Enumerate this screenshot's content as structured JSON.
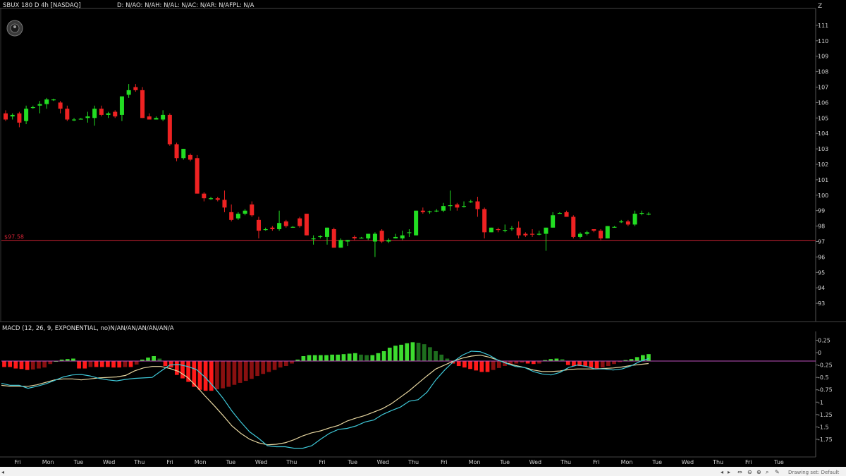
{
  "header": {
    "symbol_line": "SBUX 180 D 4h [NASDAQ]",
    "data_line": "D: N/AO: N/AH: N/AL: N/AC: N/AR: N/AFPL: N/A",
    "zoom_glyph": "Z"
  },
  "macd_header": "MACD (12, 26, 9, EXPONENTIAL, no)N/AN/AN/AN/AN/AN/A",
  "price_tag": "$97.58",
  "footer_right": "Drawing set: Default",
  "colors": {
    "up": "#22dd22",
    "down": "#ee2222",
    "up_light": "#3ddc2f",
    "up_dark": "#1e6e1e",
    "down_light": "#ff1a1a",
    "down_dark": "#8a1010",
    "macd_line": "#3ec8d8",
    "avg_line": "#e6d6a0",
    "zero_line": "#c050c0",
    "price_line": "#cc2233"
  },
  "chart_data": [
    {
      "type": "candlestick",
      "title": "SBUX 180 D 4h [NASDAQ]",
      "ylim": [
        92,
        112
      ],
      "y_ticks": [
        93,
        94,
        95,
        96,
        97,
        98,
        99,
        100,
        101,
        102,
        103,
        104,
        105,
        106,
        107,
        108,
        109,
        110,
        111
      ],
      "x_labels": [
        "Fri",
        "Mon",
        "Tue",
        "Wed",
        "Thu",
        "Fri",
        "Mon",
        "Tue",
        "Wed",
        "Thu",
        "Fri",
        "Tue",
        "Wed",
        "Thu",
        "Fri",
        "Mon",
        "Tue",
        "Wed",
        "Thu",
        "Fri",
        "Mon",
        "Tue",
        "Wed",
        "Thu",
        "Fri",
        "Tue"
      ],
      "horizontal_line": 97.05,
      "candles": [
        {
          "o": 105.3,
          "h": 105.5,
          "l": 104.8,
          "c": 104.9
        },
        {
          "o": 105.1,
          "h": 105.3,
          "l": 104.9,
          "c": 105.2
        },
        {
          "o": 105.3,
          "h": 105.4,
          "l": 104.4,
          "c": 104.7
        },
        {
          "o": 104.8,
          "h": 105.8,
          "l": 104.6,
          "c": 105.6
        },
        {
          "o": 105.7,
          "h": 105.8,
          "l": 105.6,
          "c": 105.7
        },
        {
          "o": 105.8,
          "h": 106.1,
          "l": 105.3,
          "c": 105.9
        },
        {
          "o": 105.9,
          "h": 106.3,
          "l": 105.6,
          "c": 106.2
        },
        {
          "o": 106.2,
          "h": 106.25,
          "l": 106.1,
          "c": 106.2
        },
        {
          "o": 106.0,
          "h": 106.1,
          "l": 105.3,
          "c": 105.6
        },
        {
          "o": 105.6,
          "h": 105.8,
          "l": 104.8,
          "c": 104.9
        },
        {
          "o": 104.9,
          "h": 105.0,
          "l": 104.8,
          "c": 104.9
        },
        {
          "o": 104.95,
          "h": 105.0,
          "l": 104.9,
          "c": 104.95
        },
        {
          "o": 105.0,
          "h": 105.4,
          "l": 104.7,
          "c": 105.1
        },
        {
          "o": 105.0,
          "h": 105.8,
          "l": 104.5,
          "c": 105.6
        },
        {
          "o": 105.6,
          "h": 105.8,
          "l": 105.1,
          "c": 105.2
        },
        {
          "o": 105.2,
          "h": 105.4,
          "l": 105.0,
          "c": 105.3
        },
        {
          "o": 105.4,
          "h": 105.5,
          "l": 105.0,
          "c": 105.1
        },
        {
          "o": 105.2,
          "h": 106.2,
          "l": 104.8,
          "c": 106.4
        },
        {
          "o": 106.5,
          "h": 107.2,
          "l": 106.3,
          "c": 106.8
        },
        {
          "o": 107.0,
          "h": 107.2,
          "l": 106.7,
          "c": 106.8
        },
        {
          "o": 106.8,
          "h": 107.0,
          "l": 105.0,
          "c": 105.0
        },
        {
          "o": 105.1,
          "h": 105.3,
          "l": 104.9,
          "c": 104.9
        },
        {
          "o": 104.9,
          "h": 105.1,
          "l": 104.9,
          "c": 105.0
        },
        {
          "o": 104.9,
          "h": 105.5,
          "l": 104.8,
          "c": 105.2
        },
        {
          "o": 105.2,
          "h": 105.3,
          "l": 103.2,
          "c": 103.3
        },
        {
          "o": 103.3,
          "h": 103.4,
          "l": 102.2,
          "c": 102.4
        },
        {
          "o": 102.4,
          "h": 103.0,
          "l": 102.3,
          "c": 103.0
        },
        {
          "o": 102.6,
          "h": 102.7,
          "l": 102.2,
          "c": 102.3
        },
        {
          "o": 102.4,
          "h": 102.6,
          "l": 100.1,
          "c": 100.1
        },
        {
          "o": 100.1,
          "h": 100.2,
          "l": 99.6,
          "c": 99.8
        },
        {
          "o": 99.8,
          "h": 99.9,
          "l": 99.7,
          "c": 99.8
        },
        {
          "o": 99.8,
          "h": 99.9,
          "l": 99.6,
          "c": 99.7
        },
        {
          "o": 99.7,
          "h": 100.3,
          "l": 98.9,
          "c": 99.2
        },
        {
          "o": 98.9,
          "h": 99.4,
          "l": 98.3,
          "c": 98.4
        },
        {
          "o": 98.5,
          "h": 98.9,
          "l": 98.4,
          "c": 98.8
        },
        {
          "o": 98.8,
          "h": 99.1,
          "l": 98.7,
          "c": 99.0
        },
        {
          "o": 99.4,
          "h": 99.6,
          "l": 98.6,
          "c": 98.7
        },
        {
          "o": 98.4,
          "h": 98.6,
          "l": 97.2,
          "c": 97.7
        },
        {
          "o": 97.8,
          "h": 97.9,
          "l": 97.7,
          "c": 97.8
        },
        {
          "o": 97.9,
          "h": 98.0,
          "l": 97.7,
          "c": 97.8
        },
        {
          "o": 97.8,
          "h": 99.0,
          "l": 97.7,
          "c": 98.2
        },
        {
          "o": 98.3,
          "h": 98.4,
          "l": 97.9,
          "c": 98.0
        },
        {
          "o": 97.95,
          "h": 98.0,
          "l": 97.9,
          "c": 97.95
        },
        {
          "o": 98.5,
          "h": 98.6,
          "l": 97.9,
          "c": 98.0
        },
        {
          "o": 98.8,
          "h": 98.8,
          "l": 97.4,
          "c": 97.4
        },
        {
          "o": 97.2,
          "h": 97.4,
          "l": 96.8,
          "c": 97.2
        },
        {
          "o": 97.3,
          "h": 97.4,
          "l": 97.2,
          "c": 97.35
        },
        {
          "o": 97.3,
          "h": 97.9,
          "l": 96.8,
          "c": 97.9
        },
        {
          "o": 97.8,
          "h": 97.9,
          "l": 96.6,
          "c": 96.6
        },
        {
          "o": 96.6,
          "h": 97.2,
          "l": 96.6,
          "c": 97.1
        },
        {
          "o": 97.0,
          "h": 97.1,
          "l": 96.7,
          "c": 97.1
        },
        {
          "o": 97.3,
          "h": 97.4,
          "l": 97.1,
          "c": 97.2
        },
        {
          "o": 97.25,
          "h": 97.3,
          "l": 97.2,
          "c": 97.25
        },
        {
          "o": 97.2,
          "h": 97.5,
          "l": 97.1,
          "c": 97.5
        },
        {
          "o": 97.0,
          "h": 97.6,
          "l": 96.0,
          "c": 97.5
        },
        {
          "o": 97.7,
          "h": 97.8,
          "l": 96.9,
          "c": 97.0
        },
        {
          "o": 97.0,
          "h": 97.2,
          "l": 96.9,
          "c": 97.1
        },
        {
          "o": 97.2,
          "h": 97.5,
          "l": 97.2,
          "c": 97.3
        },
        {
          "o": 97.2,
          "h": 97.7,
          "l": 97.1,
          "c": 97.4
        },
        {
          "o": 97.6,
          "h": 97.8,
          "l": 97.3,
          "c": 97.6
        },
        {
          "o": 97.4,
          "h": 99.0,
          "l": 97.4,
          "c": 99.0
        },
        {
          "o": 99.0,
          "h": 99.2,
          "l": 98.8,
          "c": 98.9
        },
        {
          "o": 98.9,
          "h": 99.0,
          "l": 98.8,
          "c": 98.95
        },
        {
          "o": 99.0,
          "h": 99.1,
          "l": 98.9,
          "c": 99.0
        },
        {
          "o": 99.0,
          "h": 99.5,
          "l": 98.9,
          "c": 99.3
        },
        {
          "o": 99.3,
          "h": 100.3,
          "l": 99.0,
          "c": 99.35
        },
        {
          "o": 99.4,
          "h": 99.5,
          "l": 99.0,
          "c": 99.2
        },
        {
          "o": 99.25,
          "h": 99.6,
          "l": 99.2,
          "c": 99.3
        },
        {
          "o": 99.6,
          "h": 99.7,
          "l": 99.5,
          "c": 99.6
        },
        {
          "o": 99.6,
          "h": 99.9,
          "l": 98.6,
          "c": 99.1
        },
        {
          "o": 99.1,
          "h": 99.2,
          "l": 97.2,
          "c": 97.6
        },
        {
          "o": 97.6,
          "h": 97.9,
          "l": 97.6,
          "c": 97.9
        },
        {
          "o": 97.8,
          "h": 97.9,
          "l": 97.6,
          "c": 97.75
        },
        {
          "o": 97.75,
          "h": 98.1,
          "l": 97.6,
          "c": 97.75
        },
        {
          "o": 97.8,
          "h": 98.0,
          "l": 97.7,
          "c": 97.85
        },
        {
          "o": 97.9,
          "h": 98.3,
          "l": 97.2,
          "c": 97.4
        },
        {
          "o": 97.5,
          "h": 97.6,
          "l": 97.3,
          "c": 97.4
        },
        {
          "o": 97.5,
          "h": 97.8,
          "l": 97.3,
          "c": 97.45
        },
        {
          "o": 97.5,
          "h": 97.7,
          "l": 97.4,
          "c": 97.5
        },
        {
          "o": 97.5,
          "h": 97.9,
          "l": 96.4,
          "c": 97.9
        },
        {
          "o": 97.9,
          "h": 98.9,
          "l": 97.9,
          "c": 98.7
        },
        {
          "o": 98.8,
          "h": 98.9,
          "l": 98.8,
          "c": 98.85
        },
        {
          "o": 98.9,
          "h": 99.0,
          "l": 98.6,
          "c": 98.6
        },
        {
          "o": 98.6,
          "h": 98.7,
          "l": 97.2,
          "c": 97.3
        },
        {
          "o": 97.3,
          "h": 97.6,
          "l": 97.2,
          "c": 97.5
        },
        {
          "o": 97.5,
          "h": 97.7,
          "l": 97.4,
          "c": 97.6
        },
        {
          "o": 97.8,
          "h": 97.8,
          "l": 97.6,
          "c": 97.7
        },
        {
          "o": 97.7,
          "h": 97.8,
          "l": 97.1,
          "c": 97.2
        },
        {
          "o": 97.2,
          "h": 98.0,
          "l": 97.2,
          "c": 98.0
        },
        {
          "o": 97.95,
          "h": 98.0,
          "l": 97.9,
          "c": 97.95
        },
        {
          "o": 98.3,
          "h": 98.4,
          "l": 98.2,
          "c": 98.3
        },
        {
          "o": 98.3,
          "h": 98.4,
          "l": 98.0,
          "c": 98.1
        },
        {
          "o": 98.1,
          "h": 99.0,
          "l": 98.0,
          "c": 98.8
        },
        {
          "o": 98.85,
          "h": 99.0,
          "l": 98.7,
          "c": 98.85
        },
        {
          "o": 98.8,
          "h": 98.9,
          "l": 98.7,
          "c": 98.8
        }
      ]
    },
    {
      "type": "macd",
      "title": "MACD (12, 26, 9, EXPONENTIAL, no)",
      "ylim": [
        -2.05,
        0.4
      ],
      "y_ticks": [
        -1.75,
        -1.5,
        -1.25,
        -1,
        -0.75,
        -0.5,
        -0.25,
        0,
        0.25
      ],
      "zero_level": -0.17,
      "histogram": [
        -0.12,
        -0.12,
        -0.15,
        -0.16,
        -0.18,
        -0.17,
        -0.15,
        -0.13,
        -0.06,
        0.0,
        0.03,
        0.04,
        0.05,
        -0.15,
        -0.15,
        -0.12,
        -0.12,
        -0.12,
        -0.12,
        -0.13,
        -0.13,
        -0.12,
        -0.12,
        -0.07,
        0.03,
        0.07,
        0.1,
        0.05,
        -0.1,
        -0.13,
        -0.28,
        -0.35,
        -0.42,
        -0.52,
        -0.58,
        -0.6,
        -0.6,
        -0.57,
        -0.55,
        -0.52,
        -0.48,
        -0.44,
        -0.4,
        -0.36,
        -0.3,
        -0.26,
        -0.22,
        -0.18,
        -0.13,
        -0.1,
        -0.05,
        0.03,
        0.1,
        0.12,
        0.12,
        0.12,
        0.12,
        0.13,
        0.13,
        0.14,
        0.15,
        0.16,
        0.13,
        0.12,
        0.12,
        0.16,
        0.2,
        0.27,
        0.31,
        0.33,
        0.36,
        0.38,
        0.37,
        0.34,
        0.28,
        0.2,
        0.13,
        0.05,
        -0.05,
        -0.1,
        -0.13,
        -0.16,
        -0.19,
        -0.22,
        -0.22,
        -0.18,
        -0.14,
        -0.1,
        -0.07,
        -0.05,
        -0.03,
        -0.05,
        -0.06,
        -0.05,
        0.02,
        0.04,
        0.05,
        0.04,
        -0.08,
        -0.1,
        -0.1,
        -0.11,
        -0.13,
        -0.15,
        -0.13,
        -0.1,
        -0.06,
        -0.02,
        0.02,
        0.04,
        0.08,
        0.12,
        0.14
      ],
      "macd": [
        -0.62,
        -0.66,
        -0.66,
        -0.72,
        -0.68,
        -0.63,
        -0.56,
        -0.49,
        -0.45,
        -0.44,
        -0.47,
        -0.52,
        -0.55,
        -0.57,
        -0.54,
        -0.52,
        -0.51,
        -0.5,
        -0.37,
        -0.25,
        -0.24,
        -0.28,
        -0.34,
        -0.5,
        -0.7,
        -0.92,
        -1.18,
        -1.4,
        -1.6,
        -1.73,
        -1.88,
        -1.9,
        -1.9,
        -1.93,
        -1.93,
        -1.88,
        -1.75,
        -1.63,
        -1.55,
        -1.53,
        -1.48,
        -1.4,
        -1.36,
        -1.25,
        -1.17,
        -1.1,
        -0.98,
        -0.95,
        -0.8,
        -0.55,
        -0.35,
        -0.18,
        -0.05,
        0.03,
        0.02,
        -0.05,
        -0.15,
        -0.22,
        -0.28,
        -0.3,
        -0.38,
        -0.43,
        -0.45,
        -0.4,
        -0.3,
        -0.25,
        -0.28,
        -0.33,
        -0.33,
        -0.35,
        -0.33,
        -0.27,
        -0.18,
        -0.12
      ],
      "avg": [
        -0.66,
        -0.68,
        -0.68,
        -0.68,
        -0.65,
        -0.6,
        -0.55,
        -0.53,
        -0.53,
        -0.55,
        -0.53,
        -0.51,
        -0.5,
        -0.49,
        -0.46,
        -0.37,
        -0.31,
        -0.28,
        -0.28,
        -0.32,
        -0.38,
        -0.5,
        -0.68,
        -0.88,
        -1.07,
        -1.27,
        -1.48,
        -1.63,
        -1.75,
        -1.82,
        -1.86,
        -1.85,
        -1.82,
        -1.76,
        -1.68,
        -1.62,
        -1.58,
        -1.52,
        -1.47,
        -1.38,
        -1.32,
        -1.27,
        -1.2,
        -1.13,
        -1.03,
        -0.9,
        -0.77,
        -0.62,
        -0.47,
        -0.33,
        -0.25,
        -0.17,
        -0.11,
        -0.07,
        -0.05,
        -0.09,
        -0.15,
        -0.21,
        -0.26,
        -0.3,
        -0.35,
        -0.38,
        -0.38,
        -0.37,
        -0.34,
        -0.33,
        -0.33,
        -0.33,
        -0.32,
        -0.31,
        -0.29,
        -0.26,
        -0.24,
        -0.22
      ]
    }
  ]
}
